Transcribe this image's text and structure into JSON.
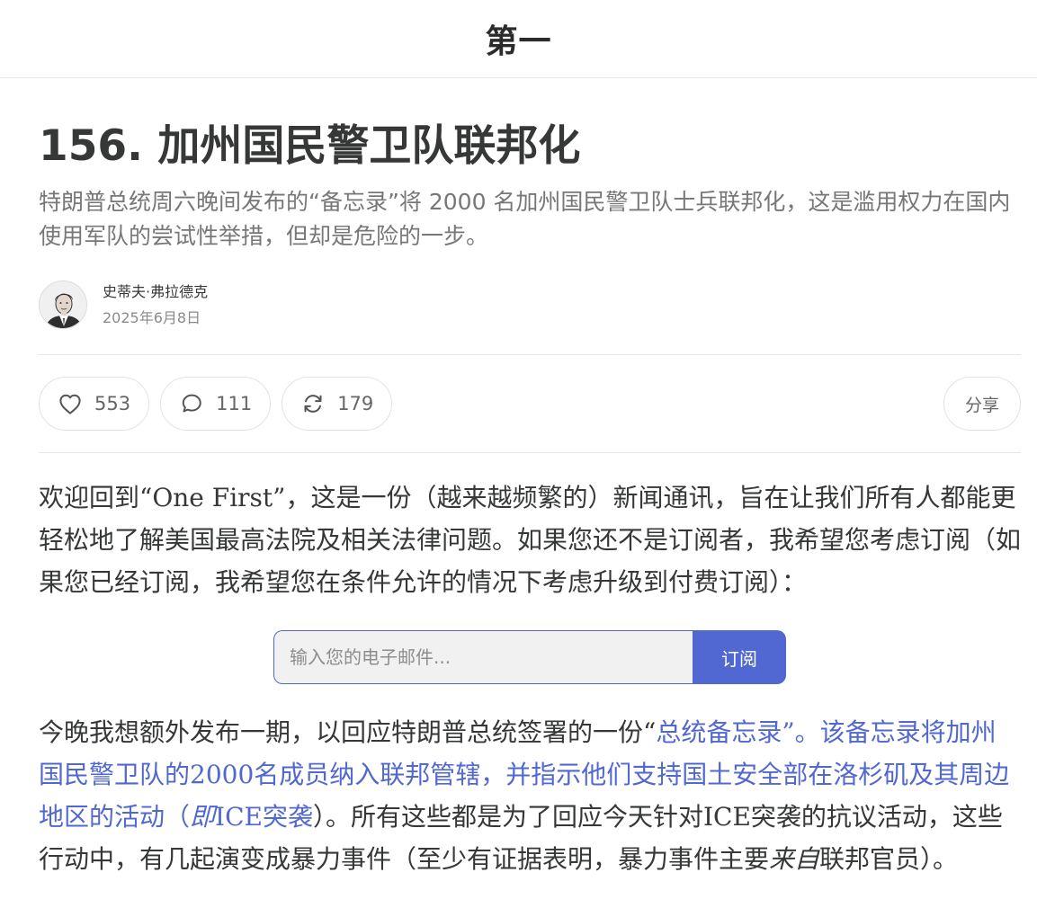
{
  "publication": {
    "title": "第一"
  },
  "post": {
    "title": "156. 加州国民警卫队联邦化",
    "subtitle": "特朗普总统周六晚间发布的“备忘录”将 2000 名加州国民警卫队士兵联邦化，这是滥用权力在国内使用军队的尝试性举措，但却是危险的一步。"
  },
  "byline": {
    "author": "史蒂夫·弗拉德克",
    "date": "2025年6月8日"
  },
  "actions": {
    "likes": "553",
    "comments": "111",
    "restacks": "179",
    "share_label": "分享"
  },
  "body": {
    "p1": "欢迎回到“One First”，这是一份（越来越频繁的）新闻通讯，旨在让我们所有人都能更轻松地了解美国最高法院及相关法律问题。如果您还不是订阅者，我希望您考虑订阅（如果您已经订阅，我希望您在条件允许的情况下考虑升级到付费订阅）：",
    "p2_a": "今晚我想额外发布一期，以回应特朗普总统签署的一份“",
    "p2_link1": "总统备忘录”",
    "p2_link2": "。该备忘录将加州国民警卫队的2000名成员纳入联邦管辖，并指示他们支持国土安全部在洛杉矶及其周边地区的活动（",
    "p2_link_em": "即",
    "p2_link3": "ICE突袭",
    "p2_b": "）。所有这些都是为了回应今天针对ICE突袭的抗议活动，这些行动中，有几起演变成暴力事件（至少有证据表明，暴力事件主要",
    "p2_em": "来自",
    "p2_c": "联邦官员）。"
  },
  "subscribe": {
    "placeholder": "输入您的电子邮件...",
    "button_label": "订阅"
  },
  "colors": {
    "accent": "#5167d2",
    "text": "#363737",
    "muted": "#777777"
  }
}
